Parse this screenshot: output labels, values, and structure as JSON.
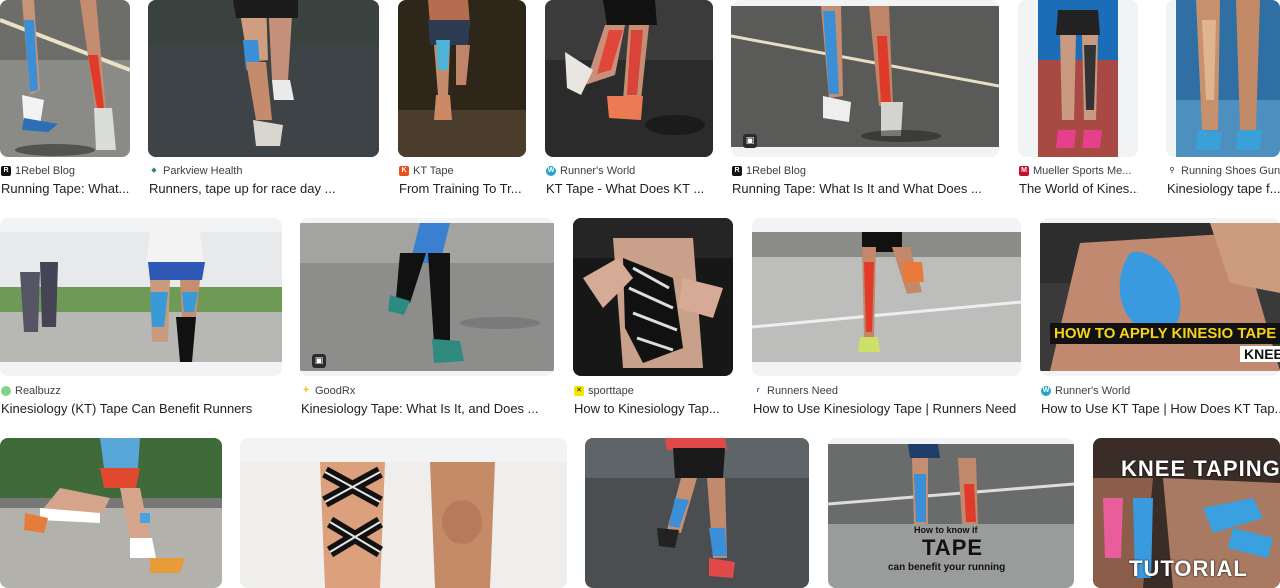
{
  "results": [
    {
      "source": "1Rebel Blog",
      "title": "Running Tape: What...",
      "favicon": "1rebel-icon",
      "fav_color": "#111111",
      "fav_glyph": "R"
    },
    {
      "source": "Parkview Health",
      "title": "Runners, tape up for race day ...",
      "favicon": "parkview-icon",
      "fav_color": "#2e8b57",
      "fav_glyph": "◆"
    },
    {
      "source": "KT Tape",
      "title": "From Training To Tr...",
      "favicon": "kt-tape-icon",
      "fav_color": "#e8501e",
      "fav_glyph": "K"
    },
    {
      "source": "Runner's World",
      "title": "KT Tape - What Does KT ...",
      "favicon": "runners-world-icon",
      "fav_color": "#27a3c9",
      "fav_glyph": "W"
    },
    {
      "source": "1Rebel Blog",
      "title": "Running Tape: What Is It and What Does ...",
      "favicon": "1rebel-icon",
      "fav_color": "#111111",
      "fav_glyph": "R"
    },
    {
      "source": "Mueller Sports Me...",
      "title": "The World of Kines...",
      "favicon": "mueller-icon",
      "fav_color": "#c8102e",
      "fav_glyph": "M"
    },
    {
      "source": "Running Shoes Guru",
      "title": "Kinesiology tape f...",
      "favicon": "running-shoes-guru-icon",
      "fav_color": "#ffffff",
      "fav_glyph": "⚲"
    },
    {
      "source": "Realbuzz",
      "title": "Kinesiology (KT) Tape Can Benefit Runners",
      "favicon": "realbuzz-icon",
      "fav_color": "#7fd38a",
      "fav_glyph": ""
    },
    {
      "source": "GoodRx",
      "title": "Kinesiology Tape: What Is It, and Does ...",
      "favicon": "goodrx-icon",
      "fav_color": "#f5c518",
      "fav_glyph": "✚"
    },
    {
      "source": "sporttape",
      "title": "How to Kinesiology Tap...",
      "favicon": "sporttape-icon",
      "fav_color": "#f2e600",
      "fav_glyph": "✕"
    },
    {
      "source": "Runners Need",
      "title": "How to Use Kinesiology Tape | Runners Need",
      "favicon": "runners-need-icon",
      "fav_color": "#ffffff",
      "fav_glyph": "ɾ"
    },
    {
      "source": "Runner's World",
      "title": "How to Use KT Tape | How Does KT Tap...",
      "favicon": "runners-world-icon",
      "fav_color": "#27a3c9",
      "fav_glyph": "W"
    },
    {
      "source": "",
      "title": "",
      "favicon": "",
      "fav_color": "",
      "fav_glyph": ""
    },
    {
      "source": "",
      "title": "",
      "favicon": "",
      "fav_color": "",
      "fav_glyph": ""
    },
    {
      "source": "",
      "title": "",
      "favicon": "",
      "fav_color": "",
      "fav_glyph": ""
    },
    {
      "source": "",
      "title": "",
      "favicon": "",
      "fav_color": "",
      "fav_glyph": ""
    },
    {
      "source": "",
      "title": "",
      "favicon": "",
      "fav_color": "",
      "fav_glyph": ""
    }
  ],
  "overlays": {
    "howto_apply": "HOW TO APPLY KINESIO TAPE",
    "knee_cut": "KNEE",
    "how_to_know": "How to know if",
    "tape": "TAPE",
    "can_benefit": "can benefit your running",
    "knee_taping": "KNEE TAPING",
    "tutorial": "TUTORIAL"
  },
  "image_badge_icon": "image-type-icon"
}
